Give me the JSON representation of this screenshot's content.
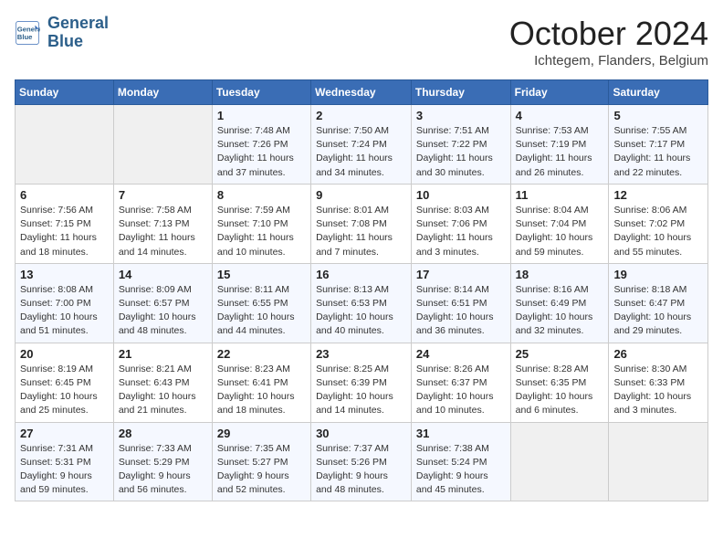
{
  "header": {
    "logo_line1": "General",
    "logo_line2": "Blue",
    "month": "October 2024",
    "location": "Ichtegem, Flanders, Belgium"
  },
  "days_of_week": [
    "Sunday",
    "Monday",
    "Tuesday",
    "Wednesday",
    "Thursday",
    "Friday",
    "Saturday"
  ],
  "weeks": [
    [
      {
        "day": "",
        "sunrise": "",
        "sunset": "",
        "daylight": ""
      },
      {
        "day": "",
        "sunrise": "",
        "sunset": "",
        "daylight": ""
      },
      {
        "day": "1",
        "sunrise": "Sunrise: 7:48 AM",
        "sunset": "Sunset: 7:26 PM",
        "daylight": "Daylight: 11 hours and 37 minutes."
      },
      {
        "day": "2",
        "sunrise": "Sunrise: 7:50 AM",
        "sunset": "Sunset: 7:24 PM",
        "daylight": "Daylight: 11 hours and 34 minutes."
      },
      {
        "day": "3",
        "sunrise": "Sunrise: 7:51 AM",
        "sunset": "Sunset: 7:22 PM",
        "daylight": "Daylight: 11 hours and 30 minutes."
      },
      {
        "day": "4",
        "sunrise": "Sunrise: 7:53 AM",
        "sunset": "Sunset: 7:19 PM",
        "daylight": "Daylight: 11 hours and 26 minutes."
      },
      {
        "day": "5",
        "sunrise": "Sunrise: 7:55 AM",
        "sunset": "Sunset: 7:17 PM",
        "daylight": "Daylight: 11 hours and 22 minutes."
      }
    ],
    [
      {
        "day": "6",
        "sunrise": "Sunrise: 7:56 AM",
        "sunset": "Sunset: 7:15 PM",
        "daylight": "Daylight: 11 hours and 18 minutes."
      },
      {
        "day": "7",
        "sunrise": "Sunrise: 7:58 AM",
        "sunset": "Sunset: 7:13 PM",
        "daylight": "Daylight: 11 hours and 14 minutes."
      },
      {
        "day": "8",
        "sunrise": "Sunrise: 7:59 AM",
        "sunset": "Sunset: 7:10 PM",
        "daylight": "Daylight: 11 hours and 10 minutes."
      },
      {
        "day": "9",
        "sunrise": "Sunrise: 8:01 AM",
        "sunset": "Sunset: 7:08 PM",
        "daylight": "Daylight: 11 hours and 7 minutes."
      },
      {
        "day": "10",
        "sunrise": "Sunrise: 8:03 AM",
        "sunset": "Sunset: 7:06 PM",
        "daylight": "Daylight: 11 hours and 3 minutes."
      },
      {
        "day": "11",
        "sunrise": "Sunrise: 8:04 AM",
        "sunset": "Sunset: 7:04 PM",
        "daylight": "Daylight: 10 hours and 59 minutes."
      },
      {
        "day": "12",
        "sunrise": "Sunrise: 8:06 AM",
        "sunset": "Sunset: 7:02 PM",
        "daylight": "Daylight: 10 hours and 55 minutes."
      }
    ],
    [
      {
        "day": "13",
        "sunrise": "Sunrise: 8:08 AM",
        "sunset": "Sunset: 7:00 PM",
        "daylight": "Daylight: 10 hours and 51 minutes."
      },
      {
        "day": "14",
        "sunrise": "Sunrise: 8:09 AM",
        "sunset": "Sunset: 6:57 PM",
        "daylight": "Daylight: 10 hours and 48 minutes."
      },
      {
        "day": "15",
        "sunrise": "Sunrise: 8:11 AM",
        "sunset": "Sunset: 6:55 PM",
        "daylight": "Daylight: 10 hours and 44 minutes."
      },
      {
        "day": "16",
        "sunrise": "Sunrise: 8:13 AM",
        "sunset": "Sunset: 6:53 PM",
        "daylight": "Daylight: 10 hours and 40 minutes."
      },
      {
        "day": "17",
        "sunrise": "Sunrise: 8:14 AM",
        "sunset": "Sunset: 6:51 PM",
        "daylight": "Daylight: 10 hours and 36 minutes."
      },
      {
        "day": "18",
        "sunrise": "Sunrise: 8:16 AM",
        "sunset": "Sunset: 6:49 PM",
        "daylight": "Daylight: 10 hours and 32 minutes."
      },
      {
        "day": "19",
        "sunrise": "Sunrise: 8:18 AM",
        "sunset": "Sunset: 6:47 PM",
        "daylight": "Daylight: 10 hours and 29 minutes."
      }
    ],
    [
      {
        "day": "20",
        "sunrise": "Sunrise: 8:19 AM",
        "sunset": "Sunset: 6:45 PM",
        "daylight": "Daylight: 10 hours and 25 minutes."
      },
      {
        "day": "21",
        "sunrise": "Sunrise: 8:21 AM",
        "sunset": "Sunset: 6:43 PM",
        "daylight": "Daylight: 10 hours and 21 minutes."
      },
      {
        "day": "22",
        "sunrise": "Sunrise: 8:23 AM",
        "sunset": "Sunset: 6:41 PM",
        "daylight": "Daylight: 10 hours and 18 minutes."
      },
      {
        "day": "23",
        "sunrise": "Sunrise: 8:25 AM",
        "sunset": "Sunset: 6:39 PM",
        "daylight": "Daylight: 10 hours and 14 minutes."
      },
      {
        "day": "24",
        "sunrise": "Sunrise: 8:26 AM",
        "sunset": "Sunset: 6:37 PM",
        "daylight": "Daylight: 10 hours and 10 minutes."
      },
      {
        "day": "25",
        "sunrise": "Sunrise: 8:28 AM",
        "sunset": "Sunset: 6:35 PM",
        "daylight": "Daylight: 10 hours and 6 minutes."
      },
      {
        "day": "26",
        "sunrise": "Sunrise: 8:30 AM",
        "sunset": "Sunset: 6:33 PM",
        "daylight": "Daylight: 10 hours and 3 minutes."
      }
    ],
    [
      {
        "day": "27",
        "sunrise": "Sunrise: 7:31 AM",
        "sunset": "Sunset: 5:31 PM",
        "daylight": "Daylight: 9 hours and 59 minutes."
      },
      {
        "day": "28",
        "sunrise": "Sunrise: 7:33 AM",
        "sunset": "Sunset: 5:29 PM",
        "daylight": "Daylight: 9 hours and 56 minutes."
      },
      {
        "day": "29",
        "sunrise": "Sunrise: 7:35 AM",
        "sunset": "Sunset: 5:27 PM",
        "daylight": "Daylight: 9 hours and 52 minutes."
      },
      {
        "day": "30",
        "sunrise": "Sunrise: 7:37 AM",
        "sunset": "Sunset: 5:26 PM",
        "daylight": "Daylight: 9 hours and 48 minutes."
      },
      {
        "day": "31",
        "sunrise": "Sunrise: 7:38 AM",
        "sunset": "Sunset: 5:24 PM",
        "daylight": "Daylight: 9 hours and 45 minutes."
      },
      {
        "day": "",
        "sunrise": "",
        "sunset": "",
        "daylight": ""
      },
      {
        "day": "",
        "sunrise": "",
        "sunset": "",
        "daylight": ""
      }
    ]
  ]
}
